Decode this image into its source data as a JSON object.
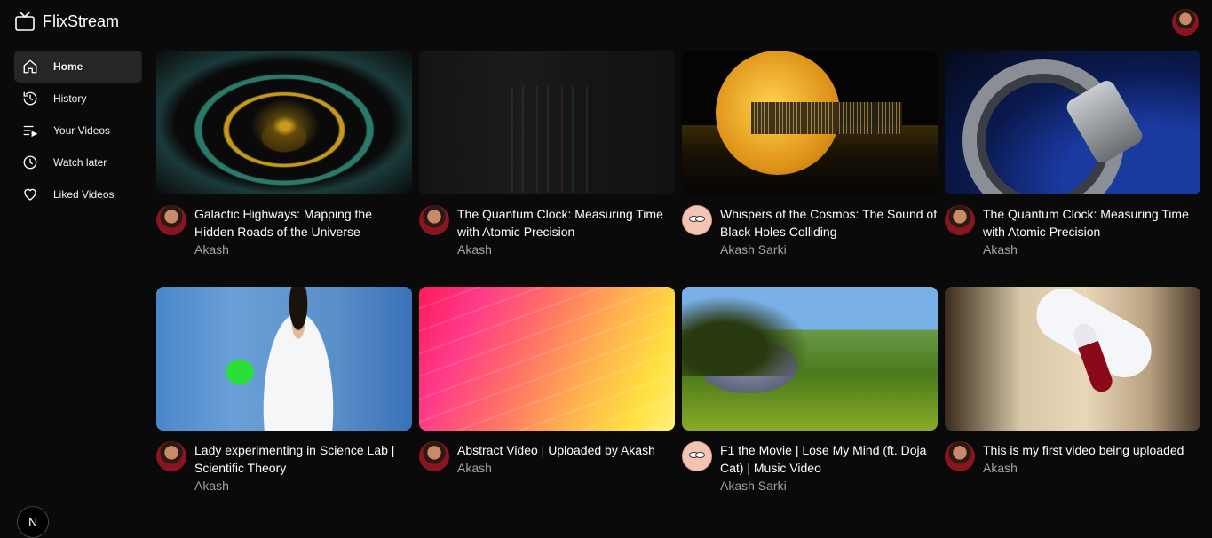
{
  "app": {
    "title": "FlixStream"
  },
  "sidebar": {
    "items": [
      {
        "label": "Home",
        "icon": "home-icon",
        "active": true
      },
      {
        "label": "History",
        "icon": "history-icon"
      },
      {
        "label": "Your Videos",
        "icon": "playlist-icon"
      },
      {
        "label": "Watch later",
        "icon": "clock-icon"
      },
      {
        "label": "Liked Videos",
        "icon": "heart-icon"
      }
    ]
  },
  "badge": {
    "letter": "N"
  },
  "videos": [
    {
      "title": "Galactic Highways: Mapping the Hidden Roads of the Universe",
      "channel": "Akash",
      "avatar": "akash"
    },
    {
      "title": "The Quantum Clock: Measuring Time with Atomic Precision",
      "channel": "Akash",
      "avatar": "akash"
    },
    {
      "title": "Whispers of the Cosmos: The Sound of Black Holes Colliding",
      "channel": "Akash Sarki",
      "avatar": "sarki"
    },
    {
      "title": "The Quantum Clock: Measuring Time with Atomic Precision",
      "channel": "Akash",
      "avatar": "akash"
    },
    {
      "title": "Lady experimenting in Science Lab | Scientific Theory",
      "channel": "Akash",
      "avatar": "akash"
    },
    {
      "title": "Abstract Video | Uploaded by Akash",
      "channel": "Akash",
      "avatar": "akash"
    },
    {
      "title": "F1 the Movie | Lose My Mind (ft. Doja Cat) | Music Video",
      "channel": "Akash Sarki",
      "avatar": "sarki"
    },
    {
      "title": "This is my first video being uploaded",
      "channel": "Akash",
      "avatar": "akash"
    }
  ]
}
